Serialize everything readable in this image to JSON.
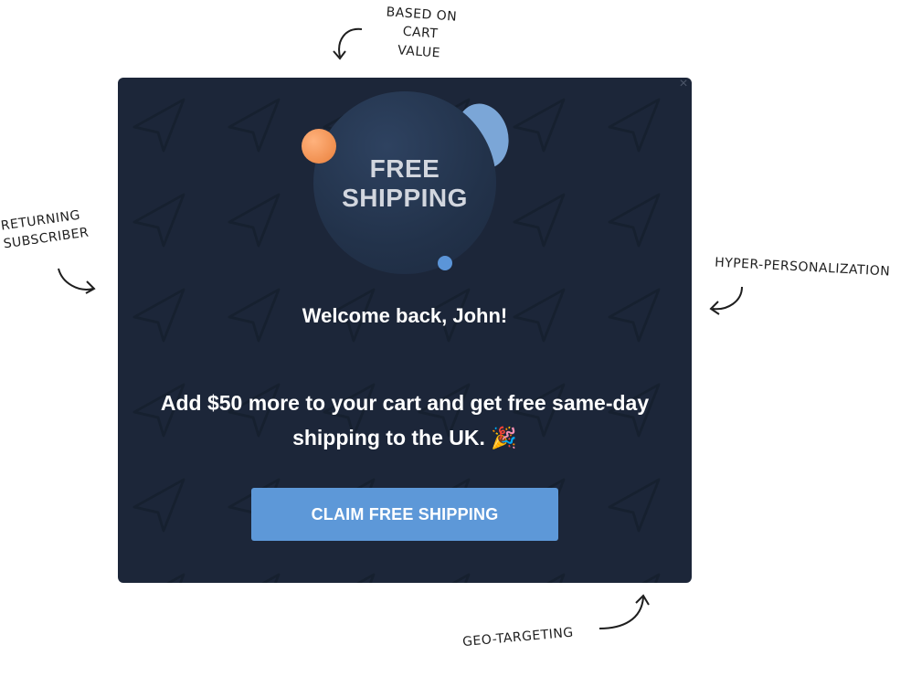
{
  "annotations": {
    "cart_value": [
      "BASED ON CART",
      "VALUE"
    ],
    "returning": [
      "RETURNING",
      "SUBSCRIBER"
    ],
    "hyper": "HYPER-PERSONALIZATION",
    "geo": "GEO-TARGETING"
  },
  "popup": {
    "close_icon": "×",
    "badge": {
      "line1": "FREE",
      "line2": "SHIPPING"
    },
    "greeting": "Welcome back, John!",
    "offer_text": "Add $50 more to your cart and get free same-day shipping to the UK. 🎉",
    "cta_label": "CLAIM FREE SHIPPING"
  },
  "colors": {
    "popup_bg": "#1c2639",
    "cta_bg": "#5d98d8",
    "orange_bubble": "#f08f4f",
    "blue_bubble": "#7ba6d7"
  }
}
